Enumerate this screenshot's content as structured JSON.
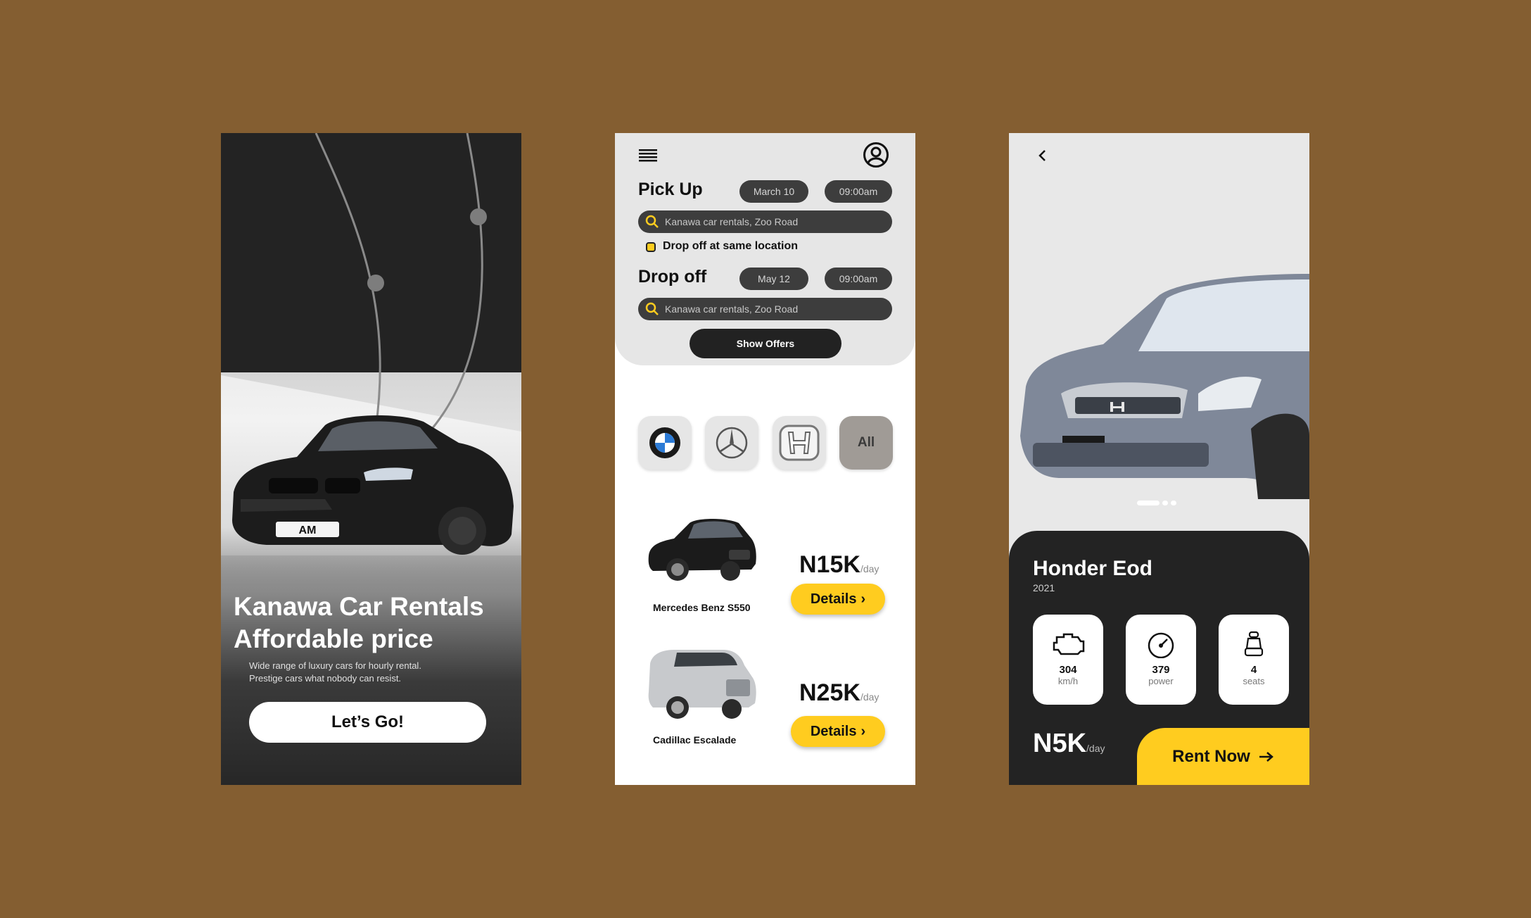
{
  "colors": {
    "background": "#845e31",
    "accent": "#ffcc1f",
    "dark": "#232323"
  },
  "splash": {
    "title_line1": "Kanawa Car Rentals",
    "title_line2": "Affordable price",
    "subtitle_line1": "Wide range of luxury cars for hourly rental.",
    "subtitle_line2": "Prestige cars what nobody can resist.",
    "cta_label": "Let’s Go!",
    "plate_text": "AM"
  },
  "booking": {
    "menu_icon": "hamburger-icon",
    "user_icon": "user-circle-icon",
    "pickup": {
      "label": "Pick Up",
      "date": "March 10",
      "time": "09:00am",
      "location_placeholder": "Kanawa car rentals, Zoo Road"
    },
    "same_location_label": "Drop off at same location",
    "dropoff": {
      "label": "Drop off",
      "date": "May 12",
      "time": "09:00am",
      "location_placeholder": "Kanawa car rentals, Zoo Road"
    },
    "show_offers_label": "Show Offers",
    "brands": [
      "BMW",
      "Mercedes-Benz",
      "Honda",
      "All"
    ],
    "cars": [
      {
        "name": "Mercedes Benz S550",
        "price": "N15K",
        "per": "/day",
        "details_label": "Details"
      },
      {
        "name": "Cadillac Escalade",
        "price": "N25K",
        "per": "/day",
        "details_label": "Details"
      }
    ]
  },
  "detail": {
    "back_icon": "chevron-left-icon",
    "car_name": "Honder Eod",
    "year": "2021",
    "specs": [
      {
        "icon": "engine-icon",
        "value": "304",
        "unit": "km/h"
      },
      {
        "icon": "speedometer-icon",
        "value": "379",
        "unit": "power"
      },
      {
        "icon": "car-seat-icon",
        "value": "4",
        "unit": "seats"
      }
    ],
    "price": "N5K",
    "per": "/day",
    "rent_label": "Rent Now"
  }
}
